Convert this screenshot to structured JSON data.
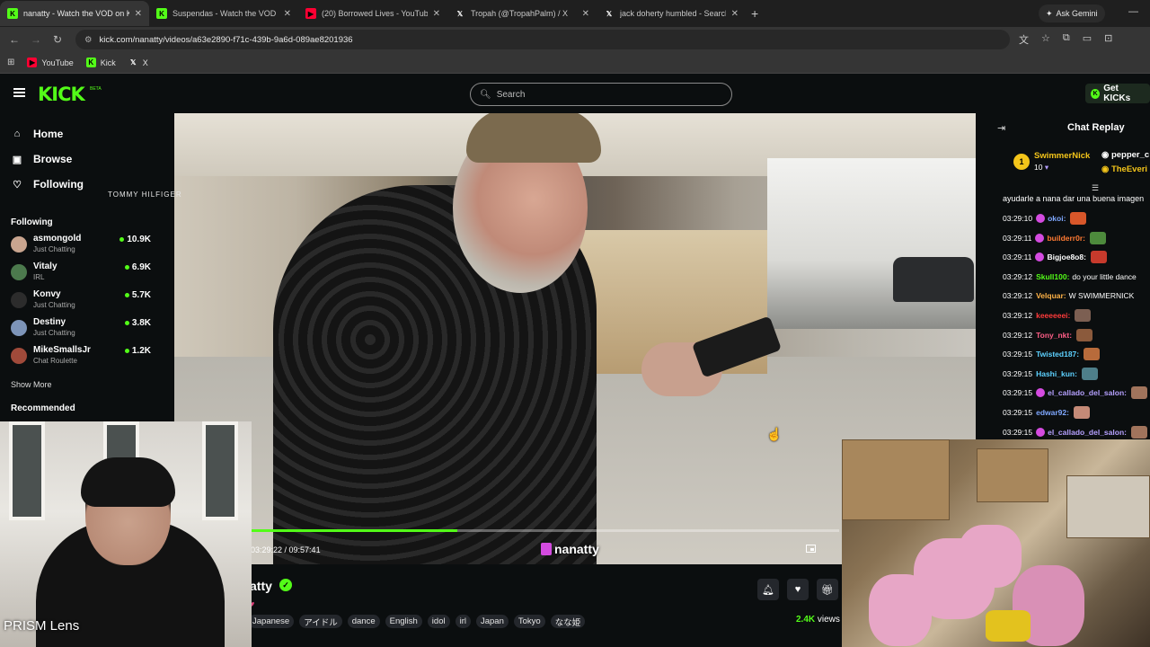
{
  "browser": {
    "tabs": [
      {
        "title": "nanatty - Watch the VOD on Ki",
        "favicon": "kick-icon",
        "fav_color": "#53fc18",
        "active": true
      },
      {
        "title": "Suspendas - Watch the VOD on",
        "favicon": "kick-icon",
        "fav_color": "#53fc18",
        "active": false
      },
      {
        "title": "(20) Borrowed Lives - YouTube",
        "favicon": "youtube-icon",
        "fav_color": "#ff0033",
        "active": false
      },
      {
        "title": "Tropah (@TropahPalm) / X",
        "favicon": "x-icon",
        "fav_color": "#ffffff",
        "active": false
      },
      {
        "title": "jack doherty humbled - Search",
        "favicon": "x-icon",
        "fav_color": "#ffffff",
        "active": false
      }
    ],
    "new_tab": "+",
    "ask_gemini": "Ask Gemini",
    "url": "kick.com/nanatty/videos/a63e2890-f71c-439b-9a6d-089ae8201936",
    "bookmarks": [
      {
        "label": "YouTube",
        "icon": "youtube-icon",
        "color": "#ff0033"
      },
      {
        "label": "Kick",
        "icon": "kick-icon",
        "color": "#53fc18"
      },
      {
        "label": "X",
        "icon": "x-icon",
        "color": "#ffffff"
      }
    ]
  },
  "kick": {
    "logo": "KICK",
    "beta": "BETA",
    "search_placeholder": "Search",
    "get_kicks": "Get KICKs",
    "accent": "#53fc18"
  },
  "sidebar": {
    "nav": [
      {
        "label": "Home",
        "icon": "home-icon"
      },
      {
        "label": "Browse",
        "icon": "browse-icon"
      },
      {
        "label": "Following",
        "icon": "heart-icon"
      }
    ],
    "following_title": "Following",
    "channels": [
      {
        "name": "asmongold",
        "category": "Just Chatting",
        "viewers": "10.9K",
        "avatar_color": "#c9a58f"
      },
      {
        "name": "Vitaly",
        "category": "IRL",
        "viewers": "6.9K",
        "avatar_color": "#4c7a4d"
      },
      {
        "name": "Konvy",
        "category": "Just Chatting",
        "viewers": "5.7K",
        "avatar_color": "#2c2c2c"
      },
      {
        "name": "Destiny",
        "category": "Just Chatting",
        "viewers": "3.8K",
        "avatar_color": "#7d94b8"
      },
      {
        "name": "MikeSmallsJr",
        "category": "Chat Roulette",
        "viewers": "1.2K",
        "avatar_color": "#a04a3a"
      }
    ],
    "show_more": "Show More",
    "recommended_title": "Recommended"
  },
  "player": {
    "timecode": "03:29:22 / 09:57:41",
    "progress": 0.3495,
    "watermark": "nanatty"
  },
  "info": {
    "name": "atty",
    "tags": [
      "Japanese",
      "アイドル",
      "dance",
      "English",
      "idol",
      "irl",
      "Japan",
      "Tokyo",
      "なな姫"
    ],
    "viewers": "2.4K",
    "viewers_suffix": " views"
  },
  "chat": {
    "title": "Chat Replay",
    "pinned": {
      "rank": "1",
      "name": "SwimmerNick",
      "count": "10",
      "other_1": "pepper_c",
      "other_2": "TheEveri"
    },
    "first_line": "ayudarle a nana dar una buena imagen",
    "messages": [
      {
        "ts": "03:29:10",
        "user": "okoi:",
        "color": "#7fa8ff",
        "badge": true,
        "text": "",
        "emote": "#d8572a"
      },
      {
        "ts": "03:29:11",
        "user": "builderr0r:",
        "color": "#ff7a33",
        "badge": true,
        "text": "",
        "emote": "#4d8a3c"
      },
      {
        "ts": "03:29:11",
        "user": "Bigjoe8o8:",
        "color": "#ffffff",
        "badge": true,
        "text": "",
        "emote": "#c73a2c"
      },
      {
        "ts": "03:29:12",
        "user": "Skull100:",
        "color": "#53fc18",
        "badge": false,
        "text": "do your little dance",
        "emote": ""
      },
      {
        "ts": "03:29:12",
        "user": "Velquar:",
        "color": "#ffb347",
        "badge": false,
        "text": "W SWIMMERNICK",
        "emote": ""
      },
      {
        "ts": "03:29:12",
        "user": "keeeeeei:",
        "color": "#ff3b3b",
        "badge": false,
        "text": "",
        "emote": "#7c5f52"
      },
      {
        "ts": "03:29:12",
        "user": "Tony_nkt:",
        "color": "#ff5e87",
        "badge": false,
        "text": "",
        "emote": "#8b5a3c"
      },
      {
        "ts": "03:29:15",
        "user": "Twisted187:",
        "color": "#5dd1ff",
        "badge": false,
        "text": "",
        "emote": "#b86b3b"
      },
      {
        "ts": "03:29:15",
        "user": "Hashi_kun:",
        "color": "#5dd1ff",
        "badge": false,
        "text": "",
        "emote": "#4e7f8a"
      },
      {
        "ts": "03:29:15",
        "user": "el_callado_del_salon:",
        "color": "#b6a1ff",
        "badge": true,
        "text": "",
        "emote": "#a1745c"
      },
      {
        "ts": "03:29:15",
        "user": "edwar92:",
        "color": "#7fa8ff",
        "badge": false,
        "text": "",
        "emote": "#c48a77"
      },
      {
        "ts": "03:29:15",
        "user": "el_callado_del_salon:",
        "color": "#b6a1ff",
        "badge": true,
        "text": "",
        "emote": "#a1745c"
      }
    ]
  },
  "facecam": {
    "shirt_brand": "TOMMY HILFIGER",
    "overlay": "PRISM Lens"
  }
}
